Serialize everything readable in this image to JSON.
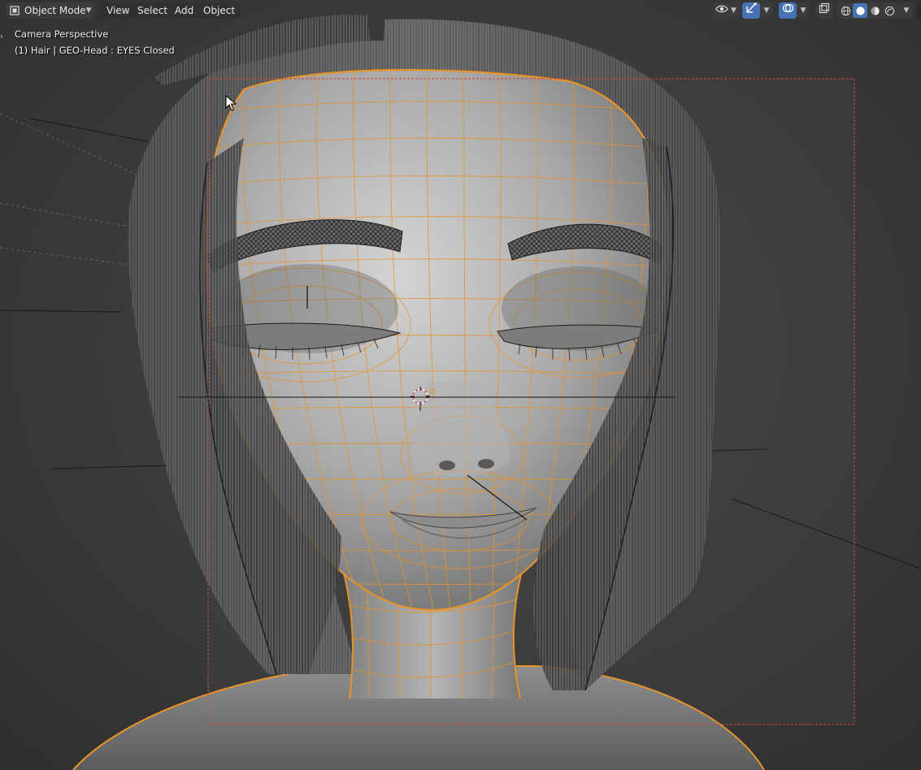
{
  "header": {
    "mode_label": "Object Mode",
    "menus": [
      {
        "label": "View"
      },
      {
        "label": "Select"
      },
      {
        "label": "Add"
      },
      {
        "label": "Object"
      }
    ],
    "right_icons": [
      "view-object-types-icon",
      "gizmo-icon",
      "overlays-icon",
      "xray-toggle-icon",
      "wireframe-shading-icon",
      "solid-shading-icon",
      "material-preview-icon",
      "rendered-shading-icon"
    ],
    "active_shading": "solid"
  },
  "overlay": {
    "view_label": "Camera Perspective",
    "object_label": "(1) Hair | GEO-Head : EYES Closed"
  },
  "colors": {
    "selection_orange": "#e8922a",
    "camera_frame": "#d04545",
    "active_blue": "#4772b3",
    "viewport_bg": "#3d3d3d"
  }
}
